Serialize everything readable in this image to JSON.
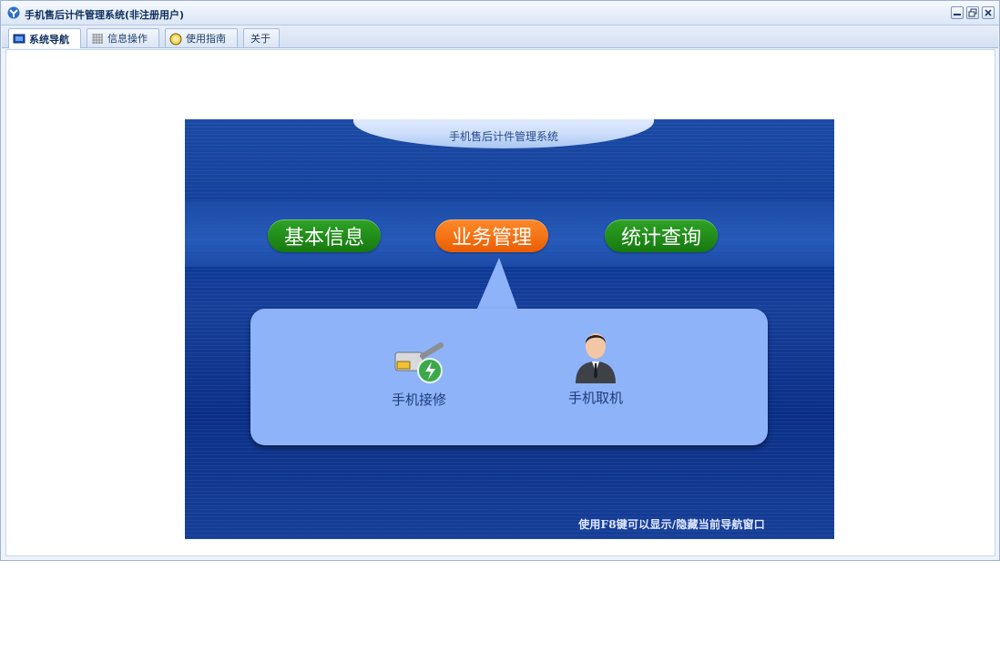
{
  "window": {
    "title": "手机售后计件管理系统(非注册用户)",
    "controls": [
      "minimize-icon",
      "restore-icon",
      "close-icon"
    ]
  },
  "tabs": [
    {
      "label": "系统导航",
      "icon": "monitor-icon",
      "active": true
    },
    {
      "label": "信息操作",
      "icon": "grid-icon",
      "active": false
    },
    {
      "label": "使用指南",
      "icon": "help-bulb-icon",
      "active": false
    },
    {
      "label": "关于",
      "icon": "",
      "active": false
    }
  ],
  "nav": {
    "header_title": "手机售后计件管理系统",
    "categories": [
      {
        "label": "基本信息",
        "color": "#1f8f1a",
        "selected": false
      },
      {
        "label": "业务管理",
        "color": "#f86b12",
        "selected": true
      },
      {
        "label": "统计查询",
        "color": "#1f8f1a",
        "selected": false
      }
    ],
    "features": [
      {
        "label": "手机接修",
        "icon": "network-plug-icon"
      },
      {
        "label": "手机取机",
        "icon": "person-icon"
      }
    ],
    "hint": "使用F8键可以显示/隐藏当前导航窗口"
  }
}
